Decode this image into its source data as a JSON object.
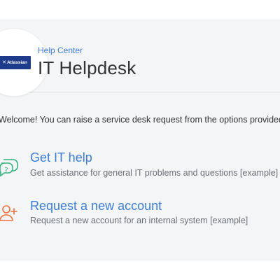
{
  "header": {
    "logo_text": "Atlassian",
    "breadcrumb": "Help Center",
    "title": "IT Helpdesk"
  },
  "welcome_text": "Welcome! You can raise a service desk request from the options provided.",
  "request_types": [
    {
      "title": "Get IT help",
      "description": "Get assistance for general IT problems and questions [example]",
      "icon": "question-bubbles-icon",
      "icon_color": "#36b37e"
    },
    {
      "title": "Request a new account",
      "description": "Request a new account for an internal system [example]",
      "icon": "add-user-icon",
      "icon_color": "#f0703a"
    }
  ],
  "colors": {
    "link": "#3b7dd8",
    "logo_bg": "#1e3a8a",
    "background": "#f4f5f7"
  }
}
